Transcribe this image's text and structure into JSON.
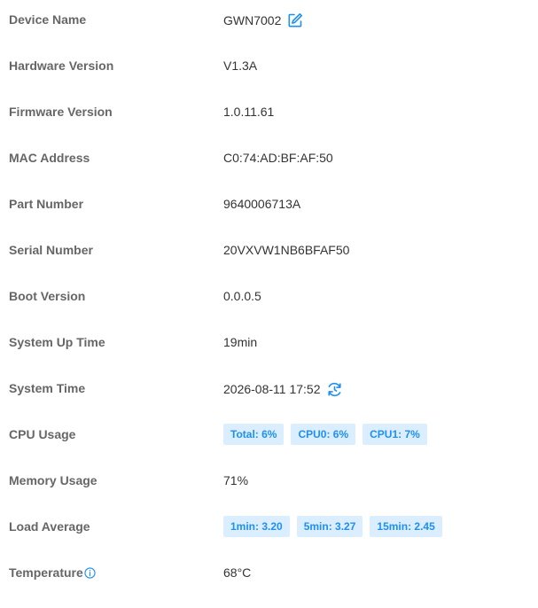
{
  "rows": [
    {
      "key": "device_name",
      "label": "Device Name",
      "value": "GWN7002"
    },
    {
      "key": "hardware_version",
      "label": "Hardware Version",
      "value": "V1.3A"
    },
    {
      "key": "firmware_version",
      "label": "Firmware Version",
      "value": "1.0.11.61"
    },
    {
      "key": "mac_address",
      "label": "MAC Address",
      "value": "C0:74:AD:BF:AF:50"
    },
    {
      "key": "part_number",
      "label": "Part Number",
      "value": "9640006713A"
    },
    {
      "key": "serial_number",
      "label": "Serial Number",
      "value": "20VXVW1NB6BFAF50"
    },
    {
      "key": "boot_version",
      "label": "Boot Version",
      "value": "0.0.0.5"
    },
    {
      "key": "system_up_time",
      "label": "System Up Time",
      "value": "19min"
    },
    {
      "key": "system_time",
      "label": "System Time",
      "value": "2026-08-11 17:52"
    },
    {
      "key": "cpu_usage",
      "label": "CPU Usage",
      "tags": [
        "Total: 6%",
        "CPU0: 6%",
        "CPU1: 7%"
      ]
    },
    {
      "key": "memory_usage",
      "label": "Memory Usage",
      "value": "71%"
    },
    {
      "key": "load_average",
      "label": "Load Average",
      "tags": [
        "1min: 3.20",
        "5min: 3.27",
        "15min: 2.45"
      ]
    },
    {
      "key": "temperature",
      "label": "Temperature",
      "value": "68°C"
    }
  ],
  "icons": {
    "edit": "edit-icon",
    "refresh": "refresh-icon",
    "info": "info-icon"
  },
  "colors": {
    "accent": "#1f8ff0",
    "tag_background": "#dbeeff",
    "label_text": "#666666",
    "value_text": "#333333"
  }
}
